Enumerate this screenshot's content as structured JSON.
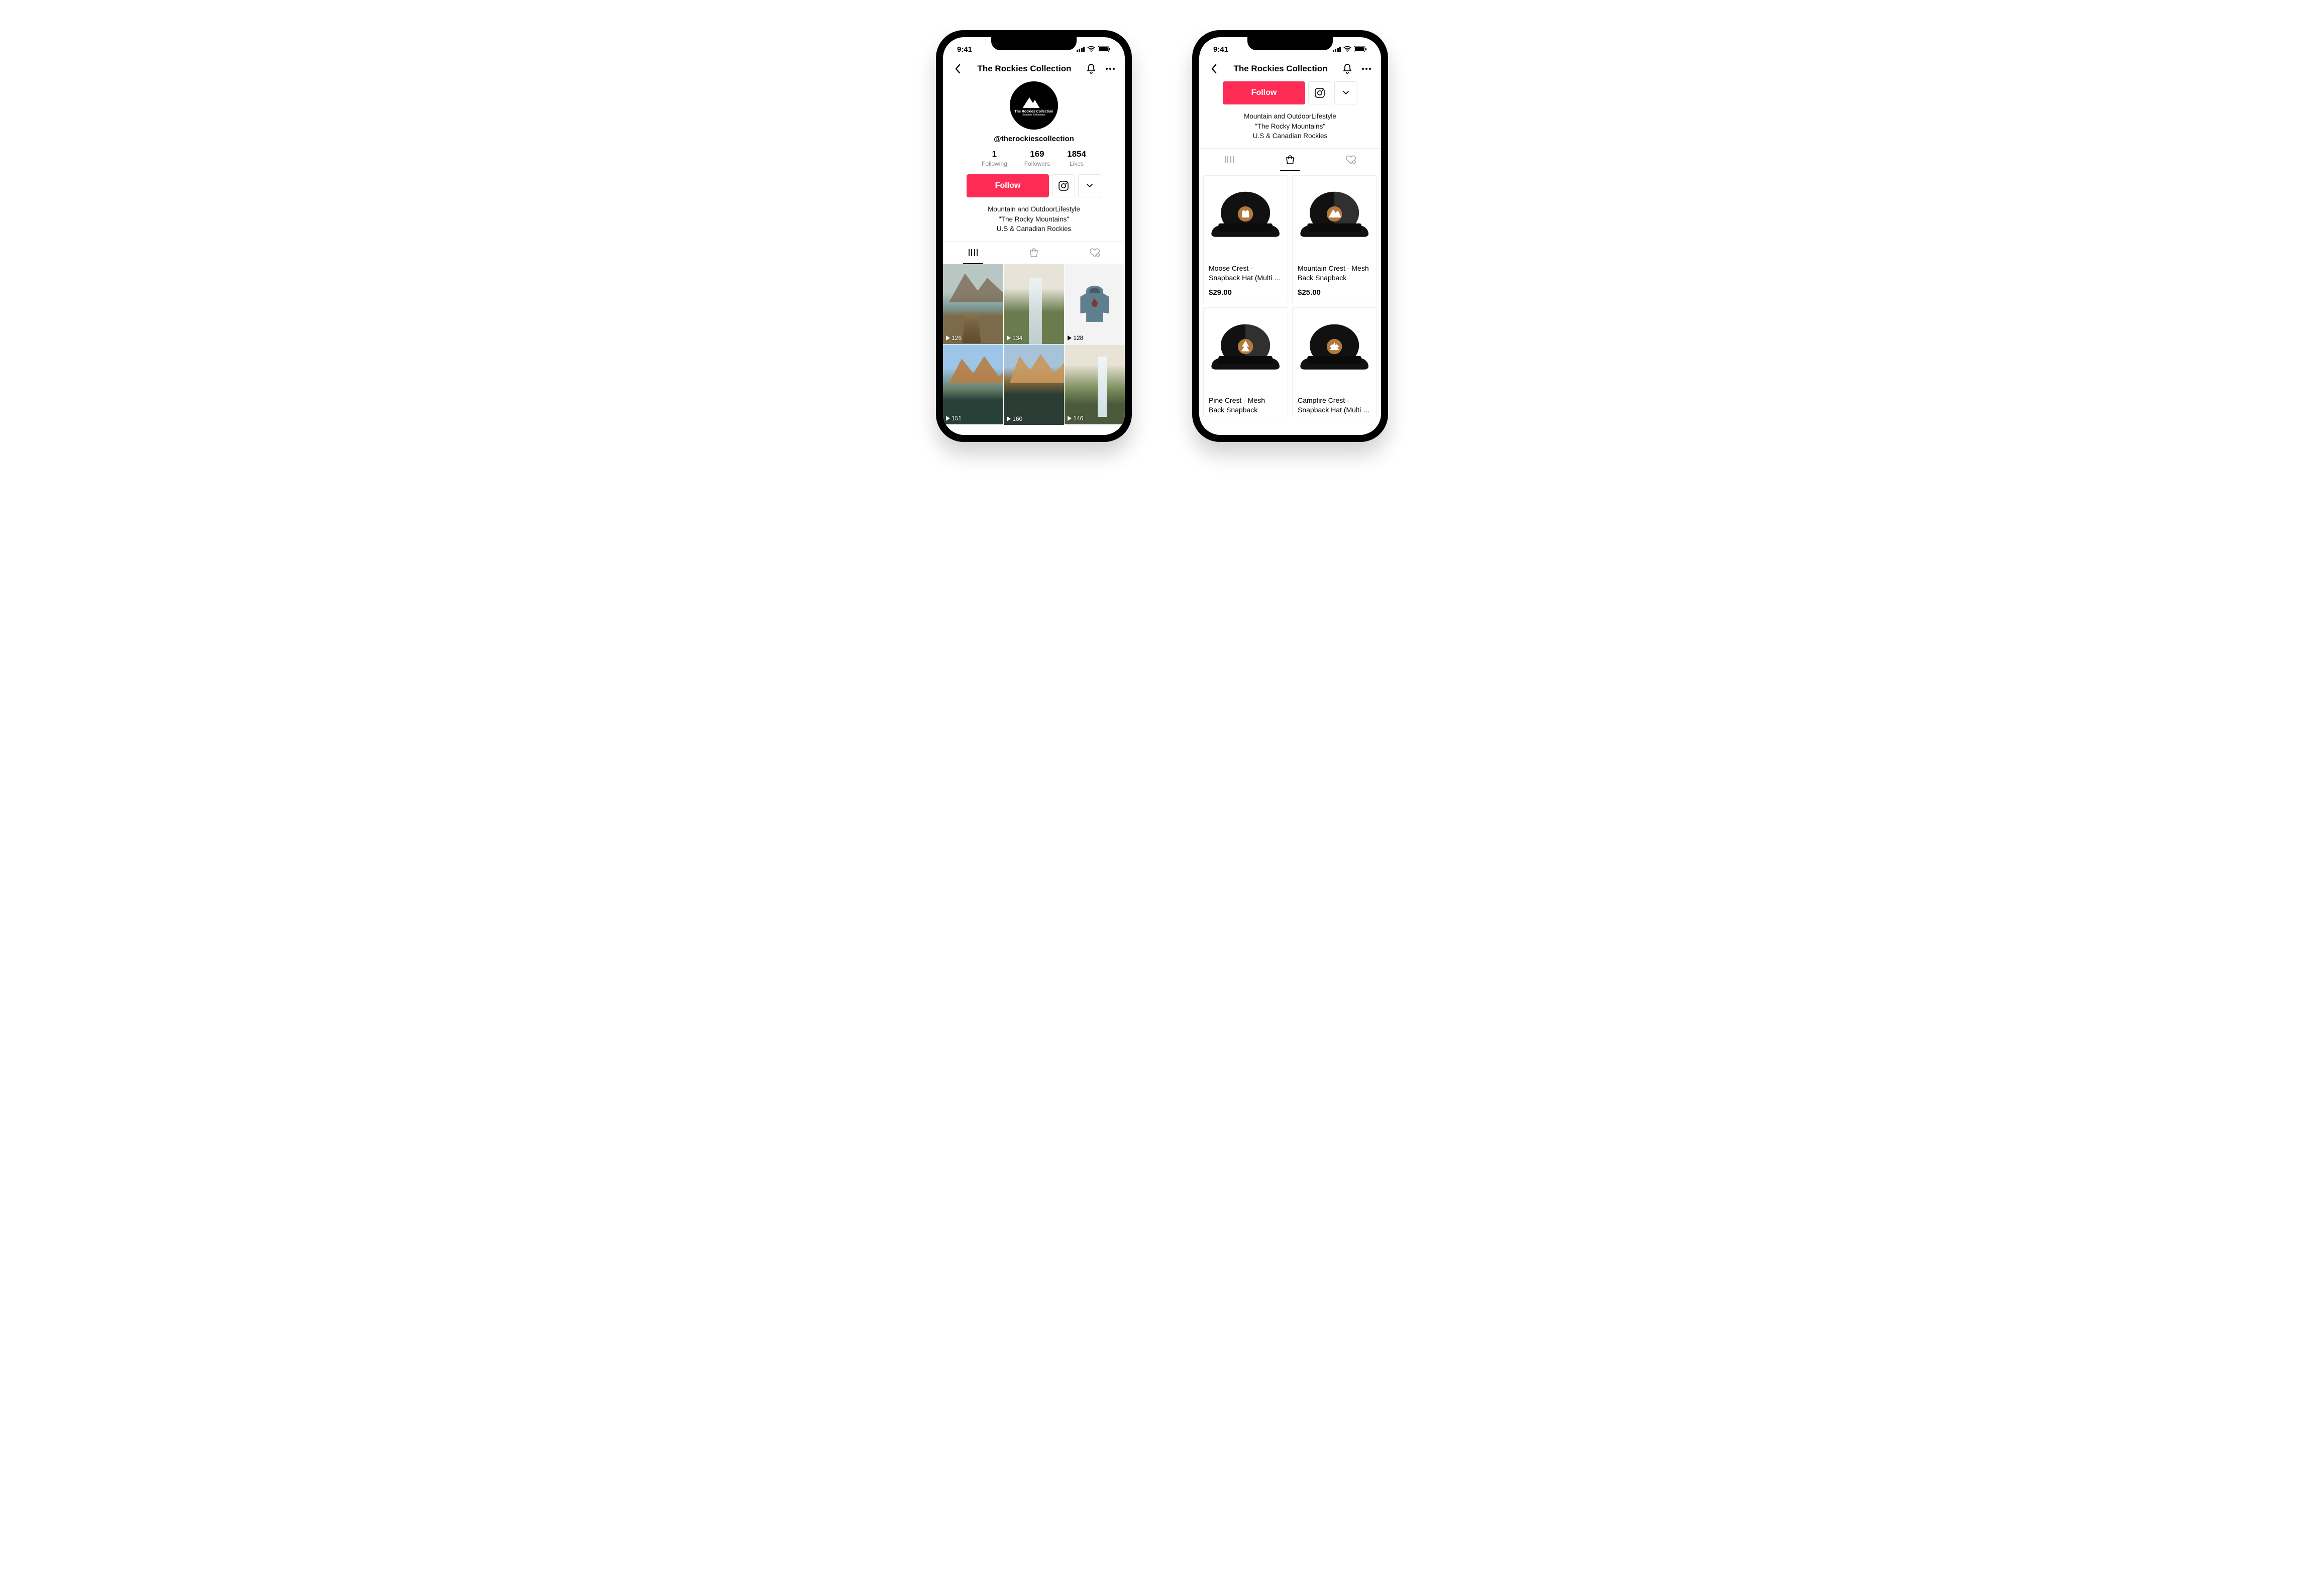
{
  "status": {
    "time": "9:41"
  },
  "header": {
    "title": "The Rockies Collection"
  },
  "avatar": {
    "brand_line1": "The Rockies Collection",
    "brand_line2": "Souvenir & Boutique"
  },
  "handle": "@therockiescollection",
  "stats": {
    "following": {
      "value": "1",
      "label": "Following"
    },
    "followers": {
      "value": "169",
      "label": "Followers"
    },
    "likes": {
      "value": "1854",
      "label": "Likes"
    }
  },
  "actions": {
    "follow": "Follow"
  },
  "bio": {
    "line1": "Mountain and OutdoorLifestyle",
    "line2": "\"The Rocky Mountains\"",
    "line3": "U.S & Canadian Rockies"
  },
  "videos": [
    {
      "views": "126"
    },
    {
      "views": "134"
    },
    {
      "views": "128"
    },
    {
      "views": "151"
    },
    {
      "views": "160"
    },
    {
      "views": "146"
    }
  ],
  "shop": {
    "products": [
      {
        "title": "Moose Crest - Snapback Hat (Multi …",
        "price": "$29.00",
        "hat_color": "#111",
        "mesh_color": "#111",
        "emblem": "moose"
      },
      {
        "title": "Mountain Crest - Mesh Back Snapback",
        "price": "$25.00",
        "hat_color": "#111",
        "mesh_color": "#333",
        "emblem": "mountain"
      },
      {
        "title": "Pine Crest - Mesh Back Snapback",
        "price": "",
        "hat_color": "#111",
        "mesh_color": "#333",
        "emblem": "pine"
      },
      {
        "title": "Campfire Crest - Snapback Hat (Multi …",
        "price": "",
        "hat_color": "#111",
        "mesh_color": "#111",
        "emblem": "campfire"
      }
    ]
  }
}
